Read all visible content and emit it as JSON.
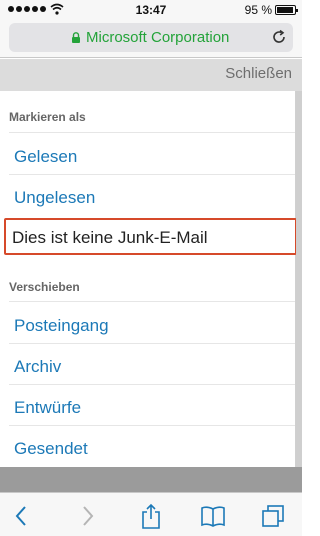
{
  "status_bar": {
    "time": "13:47",
    "battery_text": "95 %",
    "battery_level": 0.95
  },
  "address_bar": {
    "site_title": "Microsoft Corporation",
    "secure": true,
    "icons": [
      "lock-icon",
      "reload-icon"
    ]
  },
  "page": {
    "close_label": "Schließen"
  },
  "menu": {
    "mark_as": {
      "header": "Markieren als",
      "items": [
        "Gelesen",
        "Ungelesen"
      ],
      "highlighted": "Dies ist keine Junk-E-Mail"
    },
    "move": {
      "header": "Verschieben",
      "items": [
        "Posteingang",
        "Archiv",
        "Entwürfe",
        "Gesendet"
      ]
    }
  },
  "toolbar": {
    "icons": [
      "back-icon",
      "forward-icon",
      "share-icon",
      "bookmarks-icon",
      "tabs-icon"
    ],
    "forward_enabled": false
  },
  "colors": {
    "link": "#1c79b7",
    "secure_green": "#24a33a",
    "highlight_border": "#d64a2a"
  }
}
